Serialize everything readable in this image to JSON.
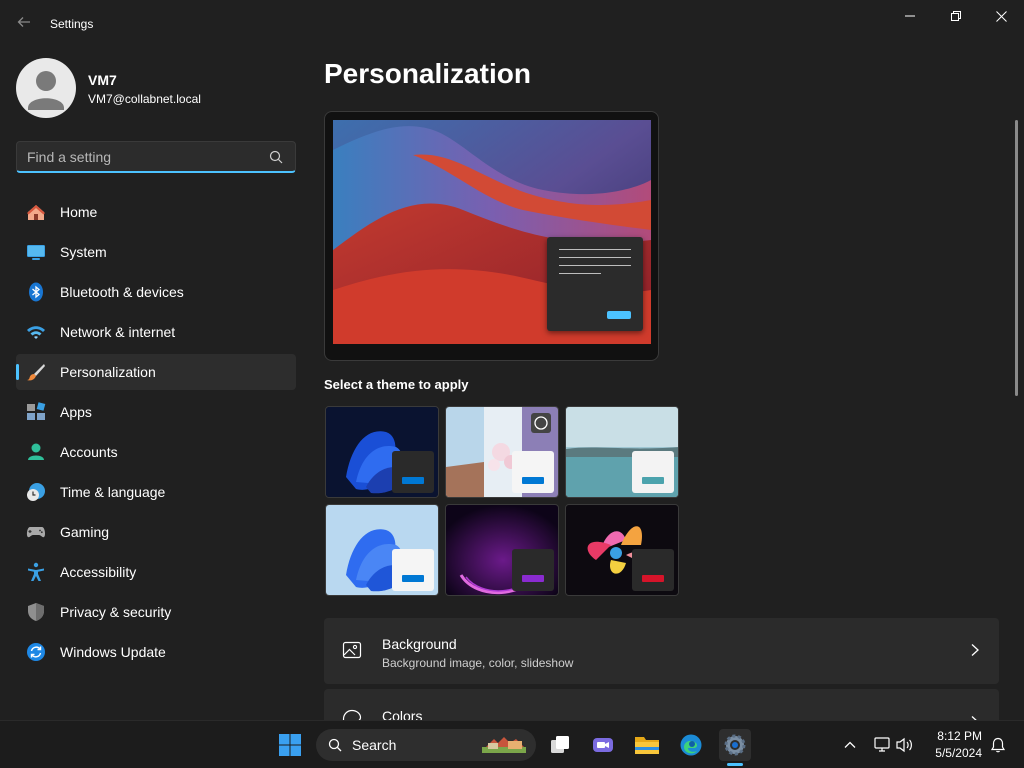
{
  "window": {
    "title": "Settings"
  },
  "user": {
    "name": "VM7",
    "email": "VM7@collabnet.local"
  },
  "search": {
    "placeholder": "Find a setting"
  },
  "sidebar": {
    "items": [
      {
        "label": "Home",
        "icon": "home-icon"
      },
      {
        "label": "System",
        "icon": "system-icon"
      },
      {
        "label": "Bluetooth & devices",
        "icon": "bluetooth-icon"
      },
      {
        "label": "Network & internet",
        "icon": "wifi-icon"
      },
      {
        "label": "Personalization",
        "icon": "brush-icon",
        "selected": true
      },
      {
        "label": "Apps",
        "icon": "apps-icon"
      },
      {
        "label": "Accounts",
        "icon": "accounts-icon"
      },
      {
        "label": "Time & language",
        "icon": "clock-globe-icon"
      },
      {
        "label": "Gaming",
        "icon": "gamepad-icon"
      },
      {
        "label": "Accessibility",
        "icon": "accessibility-icon"
      },
      {
        "label": "Privacy & security",
        "icon": "shield-icon"
      },
      {
        "label": "Windows Update",
        "icon": "update-icon"
      }
    ]
  },
  "main": {
    "title": "Personalization",
    "themes_label": "Select a theme to apply",
    "themes": [
      {
        "name": "windows-dark-bloom",
        "mini": "dark"
      },
      {
        "name": "glow-cherry-blossom",
        "mini": "light"
      },
      {
        "name": "captured-motion-lake",
        "mini": "light"
      },
      {
        "name": "windows-light-bloom",
        "mini": "light"
      },
      {
        "name": "flow-purple",
        "mini": "dark"
      },
      {
        "name": "sunrise-flower",
        "mini": "dark"
      }
    ],
    "cards": [
      {
        "title": "Background",
        "subtitle": "Background image, color, slideshow",
        "icon": "image-icon"
      },
      {
        "title": "Colors",
        "subtitle": "",
        "icon": "palette-icon"
      }
    ]
  },
  "taskbar": {
    "search_label": "Search",
    "time": "8:12 PM",
    "date": "5/5/2024"
  },
  "colors": {
    "accent": "#4cc2ff",
    "background": "#202020",
    "card": "#2b2b2b"
  }
}
